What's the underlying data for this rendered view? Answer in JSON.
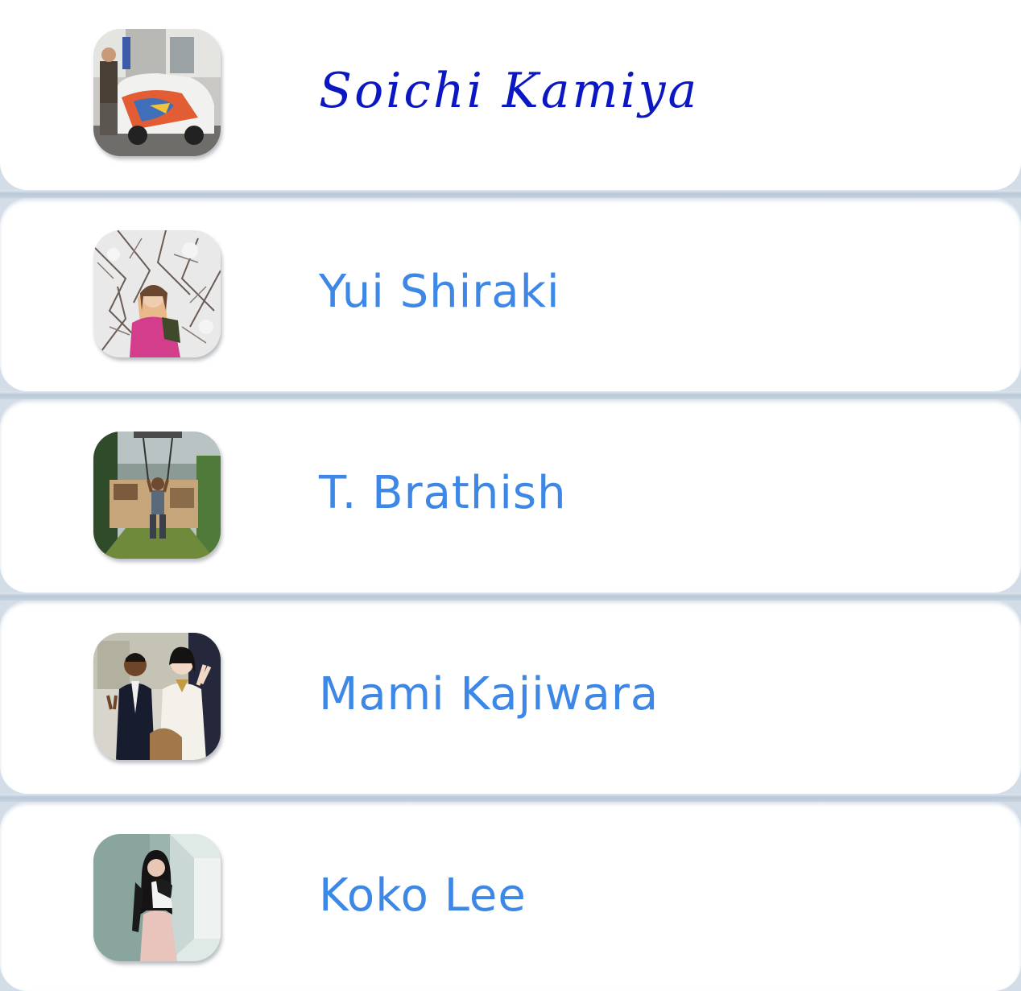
{
  "contacts": [
    {
      "name": "Soichi Kamiya",
      "avatar_icon": "photo-man-with-painted-car-icon"
    },
    {
      "name": "Yui Shiraki",
      "avatar_icon": "photo-woman-in-snowy-trees-icon"
    },
    {
      "name": "T. Brathish",
      "avatar_icon": "photo-man-on-zipline-icon"
    },
    {
      "name": "Mami Kajiwara",
      "avatar_icon": "photo-couple-at-party-icon"
    },
    {
      "name": "Koko Lee",
      "avatar_icon": "photo-woman-with-cat-icon"
    }
  ],
  "colors": {
    "selected_name": "#0a17c2",
    "name": "#3d87e6",
    "divider": "#b9c8d7"
  }
}
